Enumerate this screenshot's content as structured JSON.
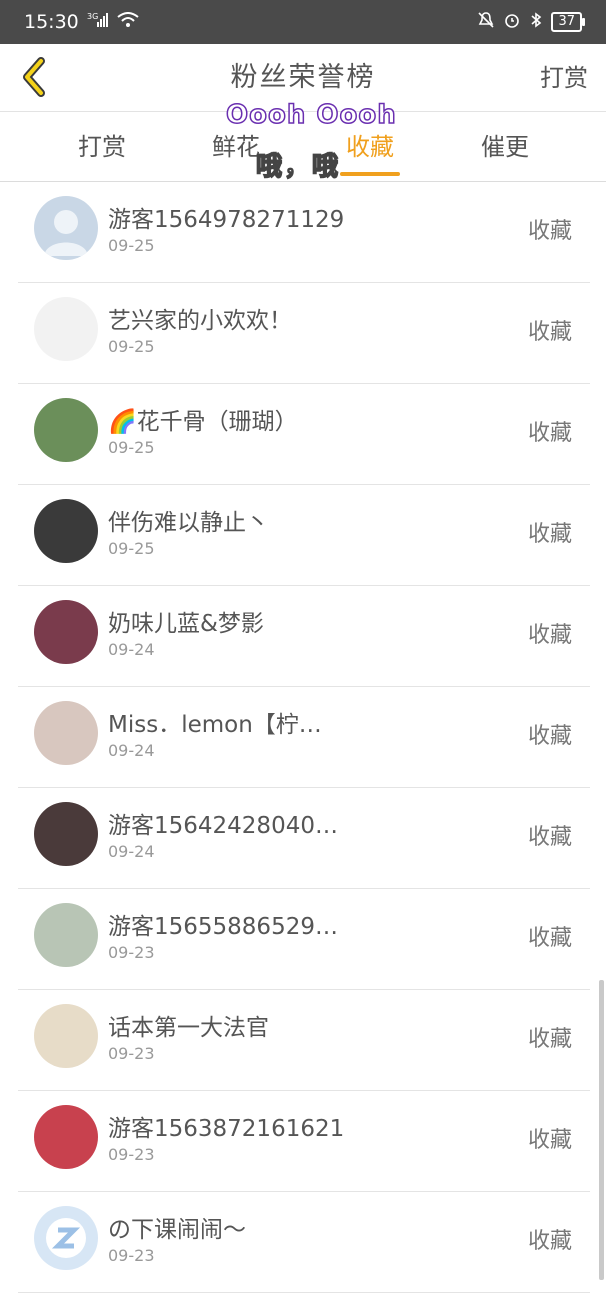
{
  "status": {
    "time": "15:30",
    "network": "3G",
    "battery": "37"
  },
  "header": {
    "title": "粉丝荣誉榜",
    "action": "打赏"
  },
  "tabs": [
    "打赏",
    "鲜花",
    "收藏",
    "催更"
  ],
  "active_tab": 2,
  "overlays": {
    "top": "Oooh Oooh",
    "bottom": "哦，哦"
  },
  "rows": [
    {
      "name": "游客1564978271129",
      "date": "09-25",
      "action": "收藏",
      "avatar_color": "#c9d7e6"
    },
    {
      "name": "艺兴家的小欢欢！",
      "date": "09-25",
      "action": "收藏",
      "avatar_color": "#f2f2f2"
    },
    {
      "name": "🌈花千骨（珊瑚）",
      "date": "09-25",
      "action": "收藏",
      "avatar_color": "#6b8f5a"
    },
    {
      "name": "伴伤难以静止丶",
      "date": "09-25",
      "action": "收藏",
      "avatar_color": "#3a3a3a"
    },
    {
      "name": "奶味儿蓝&梦影",
      "date": "09-24",
      "action": "收藏",
      "avatar_color": "#7a3b4c"
    },
    {
      "name": "Miss．lemon【柠…",
      "date": "09-24",
      "action": "收藏",
      "avatar_color": "#d8c7bf"
    },
    {
      "name": "游客15642428040…",
      "date": "09-24",
      "action": "收藏",
      "avatar_color": "#4a3a3a"
    },
    {
      "name": "游客15655886529…",
      "date": "09-23",
      "action": "收藏",
      "avatar_color": "#b8c5b5"
    },
    {
      "name": "话本第一大法官",
      "date": "09-23",
      "action": "收藏",
      "avatar_color": "#e7dcc8"
    },
    {
      "name": "游客1563872161621",
      "date": "09-23",
      "action": "收藏",
      "avatar_color": "#c8414e"
    },
    {
      "name": "の下课闹闹〜",
      "date": "09-23",
      "action": "收藏",
      "avatar_color": "#d7e6f5"
    }
  ]
}
